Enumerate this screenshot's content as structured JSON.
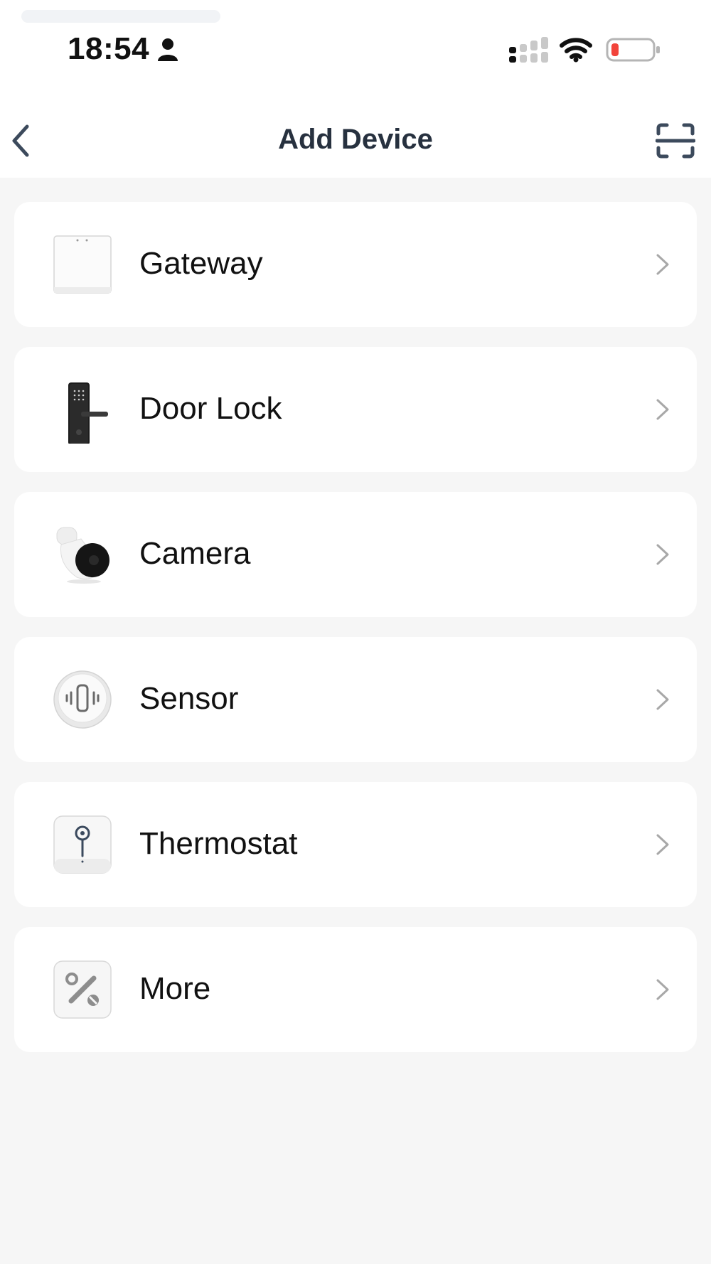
{
  "status_bar": {
    "time": "18:54"
  },
  "nav": {
    "title": "Add Device"
  },
  "devices": [
    {
      "label": "Gateway",
      "icon": "gateway-icon"
    },
    {
      "label": "Door Lock",
      "icon": "door-lock-icon"
    },
    {
      "label": "Camera",
      "icon": "camera-icon"
    },
    {
      "label": "Sensor",
      "icon": "sensor-icon"
    },
    {
      "label": "Thermostat",
      "icon": "thermostat-icon"
    },
    {
      "label": "More",
      "icon": "tools-icon"
    }
  ],
  "colors": {
    "background": "#f6f6f6",
    "card": "#ffffff",
    "title": "#27313f",
    "chevron": "#a8a8a8",
    "battery_low": "#f2443b"
  }
}
